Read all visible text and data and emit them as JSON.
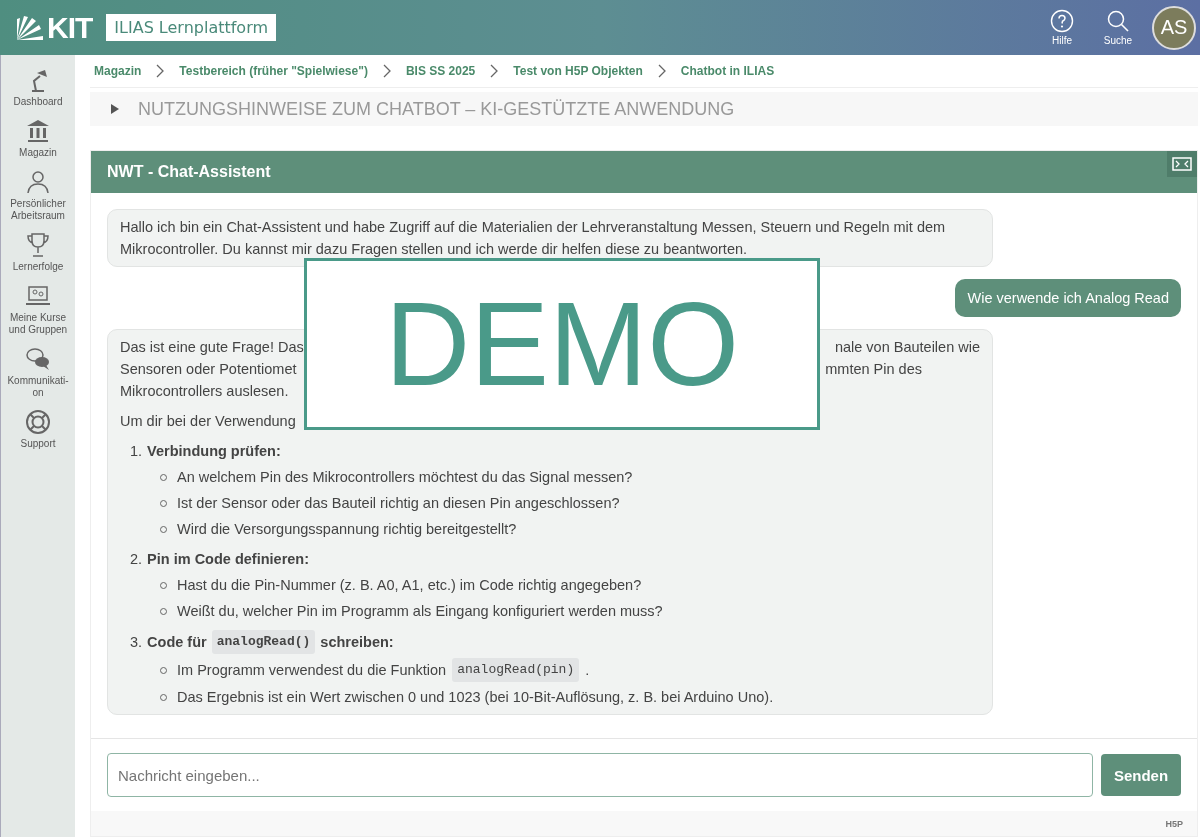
{
  "header": {
    "logo": "KIT",
    "platform": "ILIAS Lernplattform",
    "actions": [
      {
        "kind": "help",
        "label": "Hilfe"
      },
      {
        "kind": "search",
        "label": "Suche"
      }
    ],
    "avatar": "AS"
  },
  "sidebar": {
    "items": [
      {
        "kind": "lamp",
        "label": "Dashboard"
      },
      {
        "kind": "bank",
        "label": "Magazin"
      },
      {
        "kind": "person",
        "label": "Persönlicher Arbeitsraum"
      },
      {
        "kind": "trophy",
        "label": "Lernerfolge"
      },
      {
        "kind": "screen",
        "label": "Meine Kurse und Gruppen"
      },
      {
        "kind": "chat",
        "label": "Kommunikati-on"
      },
      {
        "kind": "lifebuoy",
        "label": "Support"
      }
    ]
  },
  "breadcrumbs": [
    "Magazin",
    "Testbereich (früher \"Spielwiese\")",
    "BIS SS 2025",
    "Test von H5P Objekten",
    "Chatbot in ILIAS"
  ],
  "section": {
    "title": "NUTZUNGSHINWEISE ZUM CHATBOT – KI-GESTÜTZTE ANWENDUNG",
    "expanded": false
  },
  "chat": {
    "title": "NWT - Chat-Assistent",
    "stamp": "DEMO",
    "messages": [
      {
        "kind": "bot",
        "text": "Hallo ich bin ein Chat-Assistent und habe Zugriff auf die Materialien der Lehrveranstaltung Messen, Steuern und Regeln mit dem Mikrocontroller. Du kannst mir dazu Fragen stellen und ich werde dir helfen diese zu beantworten."
      },
      {
        "kind": "user",
        "text": "Wie verwende ich Analog Read"
      },
      {
        "kind": "bot_steps",
        "fragment_lines": [
          {
            "left": "Das ist eine gute Frage! Das",
            "right": "nale von Bauteilen wie"
          },
          {
            "left": "Sensoren oder Potentiomet",
            "right": "mmten Pin des"
          },
          {
            "left": "Mikrocontrollers auslesen."
          },
          {
            "left": "Um dir bei der Verwendung"
          }
        ],
        "steps": [
          {
            "number": "1.",
            "title": [
              {
                "kind": "text",
                "text": "Verbindung prüfen:"
              }
            ],
            "points": [
              [
                {
                  "kind": "text",
                  "text": "An welchem Pin des Mikrocontrollers möchtest du das Signal messen?"
                }
              ],
              [
                {
                  "kind": "text",
                  "text": "Ist der Sensor oder das Bauteil richtig an diesen Pin angeschlossen?"
                }
              ],
              [
                {
                  "kind": "text",
                  "text": "Wird die Versorgungsspannung richtig bereitgestellt?"
                }
              ]
            ]
          },
          {
            "number": "2.",
            "title": [
              {
                "kind": "text",
                "text": "Pin im Code definieren:"
              }
            ],
            "points": [
              [
                {
                  "kind": "text",
                  "text": "Hast du die Pin-Nummer (z. B. A0, A1, etc.) im Code richtig angegeben?"
                }
              ],
              [
                {
                  "kind": "text",
                  "text": "Weißt du, welcher Pin im Programm als Eingang konfiguriert werden muss?"
                }
              ]
            ]
          },
          {
            "number": "3.",
            "title": [
              {
                "kind": "text",
                "text": "Code für"
              },
              {
                "kind": "code",
                "text": "analogRead()"
              },
              {
                "kind": "text",
                "text": "schreiben:"
              }
            ],
            "points": [
              [
                {
                  "kind": "text",
                  "text": "Im Programm verwendest du die Funktion"
                },
                {
                  "kind": "code",
                  "text": "analogRead(pin)"
                },
                {
                  "kind": "text",
                  "text": "."
                }
              ],
              [
                {
                  "kind": "text",
                  "text": "Das Ergebnis ist ein Wert zwischen 0 und 1023 (bei 10-Bit-Auflösung, z. B. bei Arduino Uno)."
                }
              ]
            ]
          }
        ]
      }
    ],
    "input": {
      "placeholder": "Nachricht eingeben..."
    },
    "send_button": "Senden",
    "footer_logo": "H5P"
  }
}
